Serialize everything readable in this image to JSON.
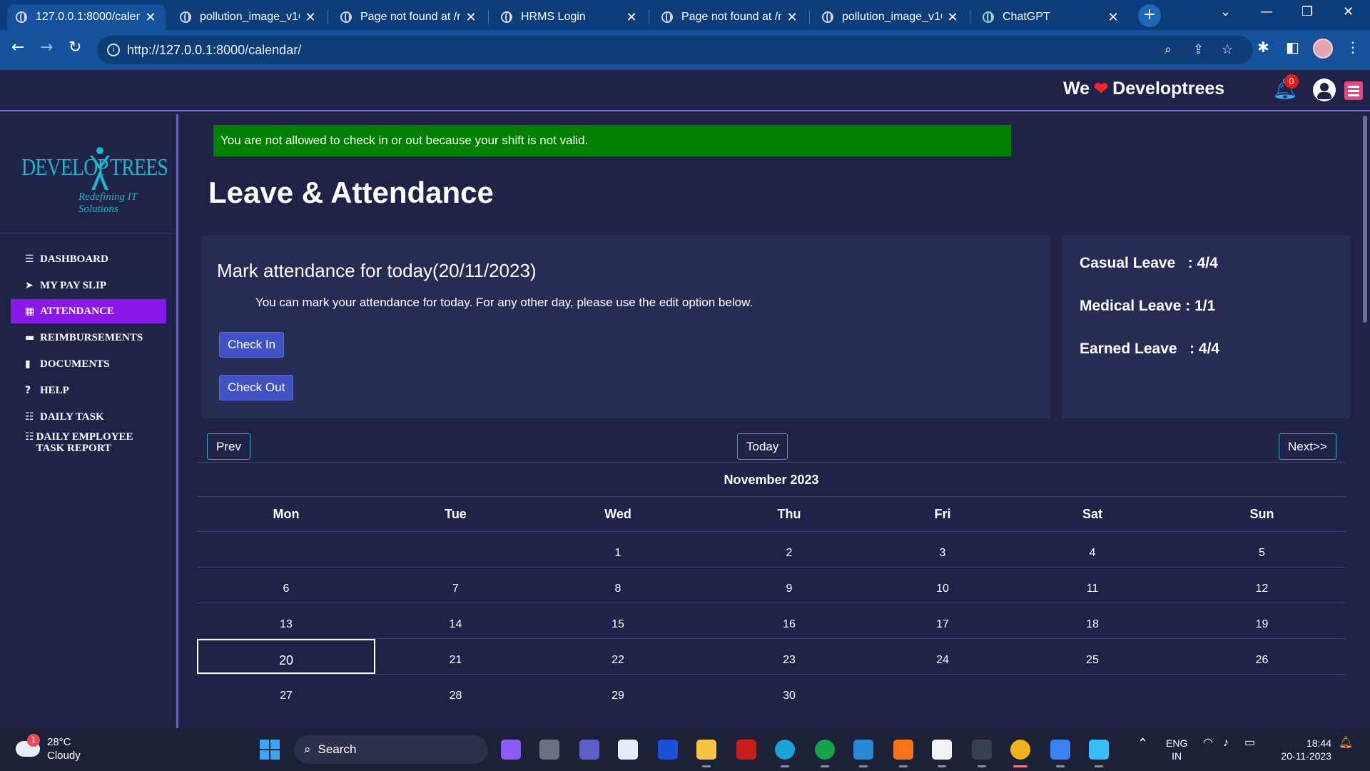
{
  "browser": {
    "tabs": [
      {
        "title": "127.0.0.1:8000/calend",
        "active": true
      },
      {
        "title": "pollution_image_v1C",
        "active": false
      },
      {
        "title": "Page not found at /m",
        "active": false
      },
      {
        "title": "HRMS Login",
        "active": false
      },
      {
        "title": "Page not found at /m",
        "active": false
      },
      {
        "title": "pollution_image_v1C",
        "active": false
      },
      {
        "title": "ChatGPT",
        "active": false
      }
    ],
    "url_prefix": "http://",
    "url_host": "127.0.0.1",
    "url_rest": ":8000/calendar/"
  },
  "header": {
    "brand_left": "We",
    "brand_right": "Developtrees",
    "notification_count": "0"
  },
  "sidebar": {
    "logo_word_left": "DEVELOP",
    "logo_word_right": "TREES",
    "logo_tagline": "Redefining IT Solutions",
    "items": [
      {
        "label": "DASHBOARD",
        "icon": "bars-icon",
        "glyph": "☰",
        "active": false
      },
      {
        "label": "MY PAY SLIP",
        "icon": "paper-plane-icon",
        "glyph": "➤",
        "active": false
      },
      {
        "label": "ATTENDANCE",
        "icon": "calendar-icon",
        "glyph": "▦",
        "active": true
      },
      {
        "label": "REIMBURSEMENTS",
        "icon": "credit-card-icon",
        "glyph": "▬",
        "active": false
      },
      {
        "label": "DOCUMENTS",
        "icon": "file-icon",
        "glyph": "▮",
        "active": false
      },
      {
        "label": "HELP",
        "icon": "question-circle-icon",
        "glyph": "?",
        "active": false
      },
      {
        "label": "DAILY TASK",
        "icon": "list-check-icon",
        "glyph": "☷",
        "active": false
      },
      {
        "label": "DAILY EMPLOYEE TASK REPORT",
        "icon": "list-check-icon",
        "glyph": "☷",
        "active": false
      }
    ]
  },
  "main": {
    "flash_message": "You are not allowed to check in or out because your shift is not valid.",
    "page_title": "Leave & Attendance",
    "attendance": {
      "heading": "Mark attendance for today(20/11/2023)",
      "note": "You can mark your attendance for today. For any other day, please use the edit option below.",
      "check_in_label": "Check In",
      "check_out_label": "Check Out"
    },
    "leaves": [
      {
        "label": "Casual Leave   :",
        "value": "4/4"
      },
      {
        "label": "Medical Leave :",
        "value": "1/1"
      },
      {
        "label": "Earned Leave   :",
        "value": "4/4"
      }
    ]
  },
  "calendar": {
    "prev_label": "Prev",
    "today_label": "Today",
    "next_label": "Next>>",
    "month_title": "November 2023",
    "weekdays": [
      "Mon",
      "Tue",
      "Wed",
      "Thu",
      "Fri",
      "Sat",
      "Sun"
    ],
    "weeks": [
      [
        "",
        "",
        "1",
        "2",
        "3",
        "4",
        "5"
      ],
      [
        "6",
        "7",
        "8",
        "9",
        "10",
        "11",
        "12"
      ],
      [
        "13",
        "14",
        "15",
        "16",
        "17",
        "18",
        "19"
      ],
      [
        "20",
        "21",
        "22",
        "23",
        "24",
        "25",
        "26"
      ],
      [
        "27",
        "28",
        "29",
        "30",
        "",
        "",
        ""
      ]
    ],
    "today": "20"
  },
  "taskbar": {
    "weather_temp": "28°C",
    "weather_desc": "Cloudy",
    "weather_badge": "1",
    "search_label": "Search",
    "lang_line1": "ENG",
    "lang_line2": "IN",
    "time": "18:44",
    "date": "20-11-2023"
  },
  "colors": {
    "page_bg": "#1f2347",
    "card_bg": "#272c55",
    "active_nav": "#8a18e8",
    "flash_bg": "#008000",
    "button_bg": "#3f51c3",
    "accent_teal": "#22b4c8"
  }
}
